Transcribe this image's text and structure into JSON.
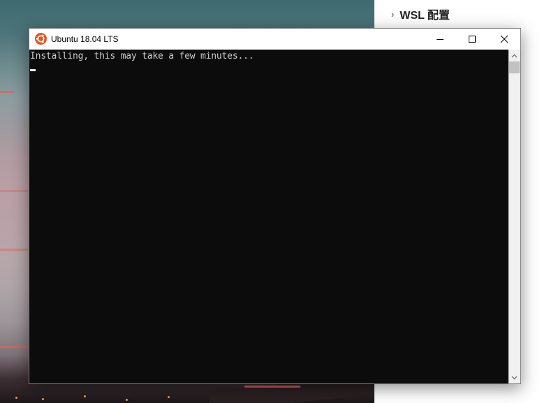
{
  "side_panel": {
    "heading": "WSL 配置",
    "chevron_icon": "chevron-right-icon"
  },
  "window": {
    "title": "Ubuntu 18.04 LTS",
    "app_icon": "ubuntu-logo-icon",
    "icon_color": "#e95420",
    "controls": {
      "minimize_icon": "minimize-icon",
      "maximize_icon": "maximize-icon",
      "close_icon": "close-icon"
    }
  },
  "terminal": {
    "output_line": "Installing, this may take a few minutes...",
    "background": "#0c0c0c",
    "text_color": "#cccccc"
  },
  "scrollbar": {
    "up_icon": "scroll-up-arrow-icon",
    "down_icon": "scroll-down-arrow-icon"
  }
}
